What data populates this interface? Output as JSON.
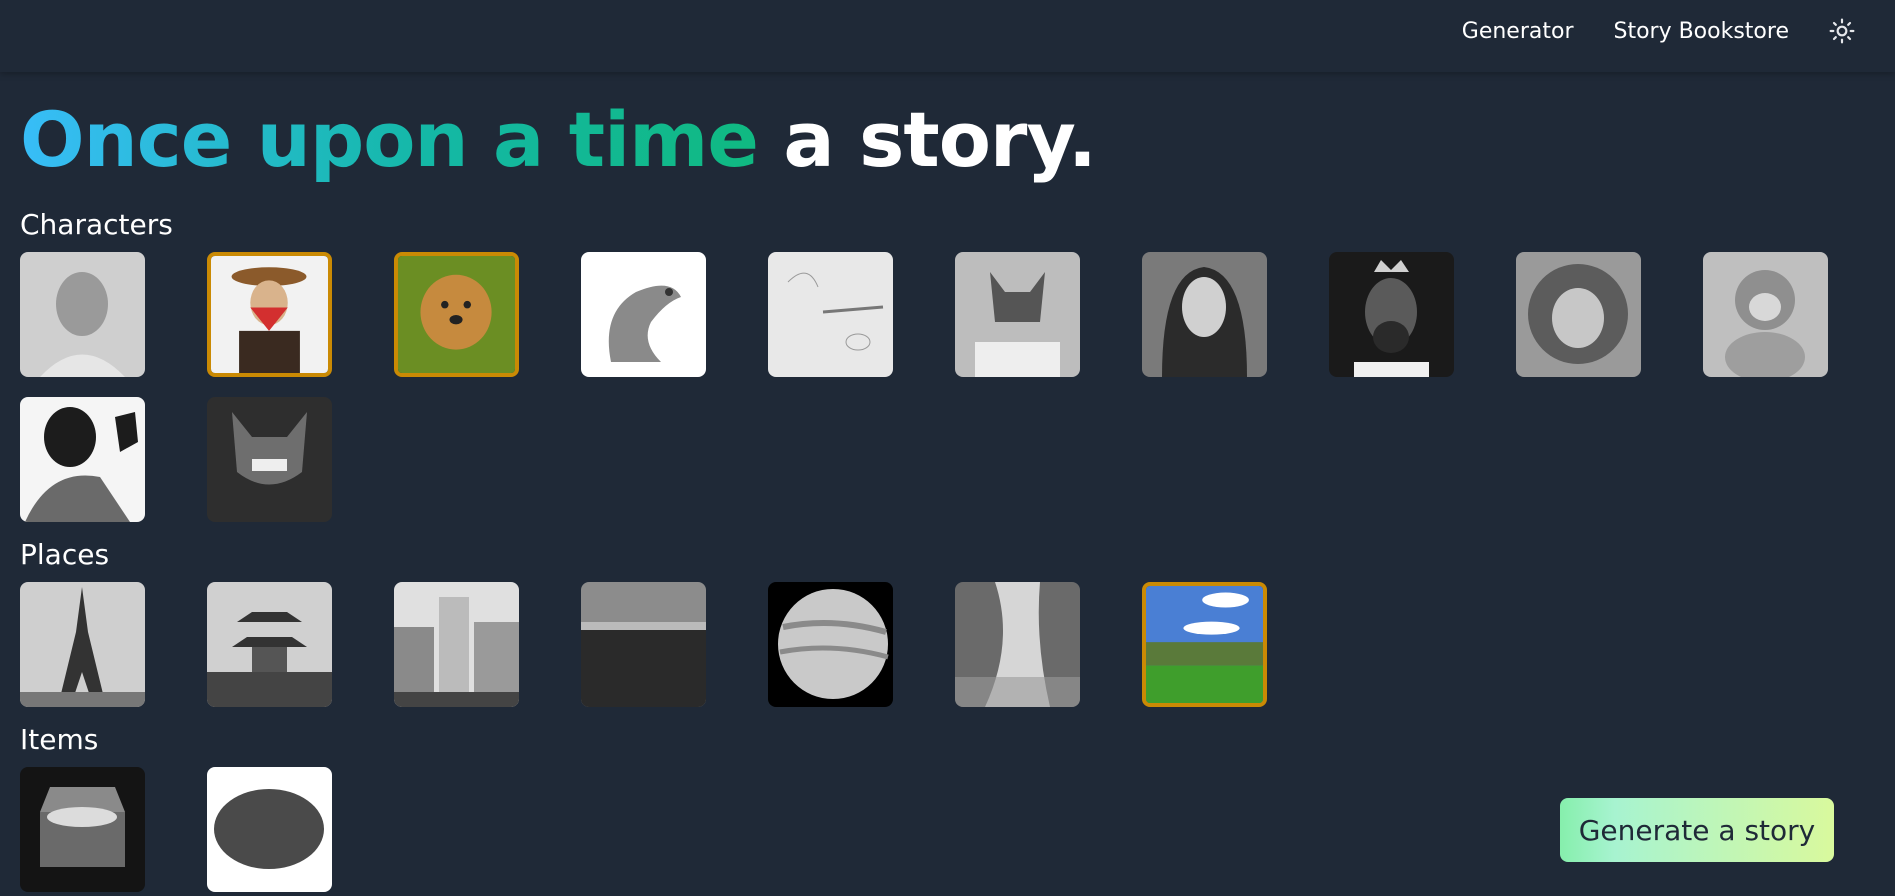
{
  "nav": {
    "generator": "Generator",
    "bookstore": "Story Bookstore",
    "theme_icon": "sun-icon"
  },
  "hero": {
    "part1": "Once upon a time",
    "part2": "a story."
  },
  "sections": {
    "characters": "Characters",
    "places": "Places",
    "items": "Items"
  },
  "characters": [
    {
      "name": "boy",
      "selected": false
    },
    {
      "name": "cowboy-bandit",
      "selected": true
    },
    {
      "name": "golden-retriever",
      "selected": true
    },
    {
      "name": "dragon",
      "selected": false
    },
    {
      "name": "pencil-sketch",
      "selected": false
    },
    {
      "name": "gargoyle",
      "selected": false
    },
    {
      "name": "woman",
      "selected": false
    },
    {
      "name": "king",
      "selected": false
    },
    {
      "name": "lion",
      "selected": false
    },
    {
      "name": "monkey",
      "selected": false
    },
    {
      "name": "masked-thief",
      "selected": false
    },
    {
      "name": "demon",
      "selected": false
    }
  ],
  "places": [
    {
      "name": "eiffel-tower",
      "selected": false
    },
    {
      "name": "pagoda",
      "selected": false
    },
    {
      "name": "church",
      "selected": false
    },
    {
      "name": "seashore",
      "selected": false
    },
    {
      "name": "planet",
      "selected": false
    },
    {
      "name": "river",
      "selected": false
    },
    {
      "name": "countryside",
      "selected": true
    }
  ],
  "items": [
    {
      "name": "treasure-chest",
      "selected": false
    },
    {
      "name": "stone",
      "selected": false
    }
  ],
  "accent_color": "#ca8a04",
  "generate_button": "Generate a story"
}
